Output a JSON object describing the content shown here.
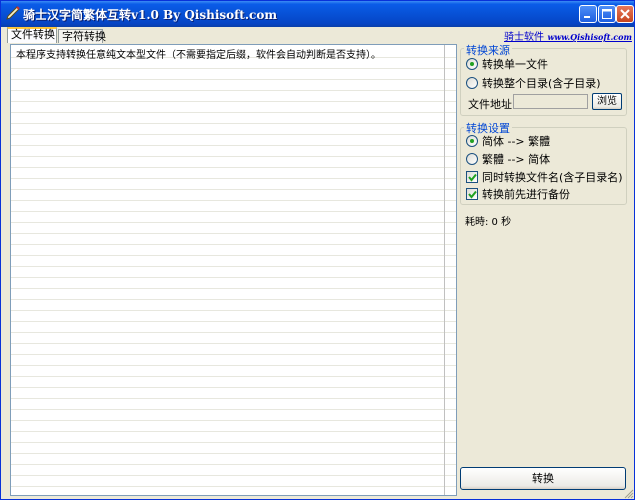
{
  "window": {
    "title": "骑士汉字简繁体互转v1.0 By Qishisoft.com"
  },
  "tabs": [
    {
      "label": "文件转换",
      "active": true
    },
    {
      "label": "字符转换",
      "active": false
    }
  ],
  "brand_link": {
    "name": "骑士软件",
    "url_text": "www.Qishisoft.com"
  },
  "textarea": {
    "value": "本程序支持转换任意纯文本型文件（不需要指定后缀，软件会自动判断是否支持）。"
  },
  "source_group": {
    "title": "转换来源",
    "options": [
      {
        "label": "转换单一文件",
        "selected": true
      },
      {
        "label": "转换整个目录(含子目录)",
        "selected": false
      }
    ],
    "path_label": "文件地址",
    "path_value": "",
    "browse_label": "浏览"
  },
  "settings_group": {
    "title": "转换设置",
    "options": [
      {
        "label": "简体 --> 繁體",
        "selected": true
      },
      {
        "label": "繁體 --> 简体",
        "selected": false
      }
    ],
    "checks": [
      {
        "label": "同时转换文件名(含子目录名)",
        "checked": true
      },
      {
        "label": "转换前先进行备份",
        "checked": true
      }
    ]
  },
  "elapsed": "耗時: 0 秒",
  "convert_label": "转换",
  "colors": {
    "titlebar": "#0751d6",
    "group_title": "#0046d5",
    "link": "#0000cc",
    "face": "#ece9d8"
  }
}
